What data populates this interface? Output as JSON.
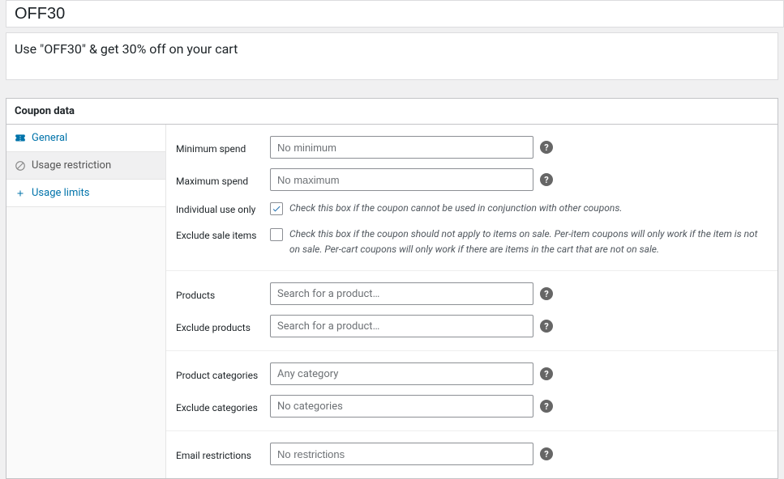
{
  "title": "OFF30",
  "description": "Use \"OFF30\" & get 30% off on your cart",
  "panel": {
    "title": "Coupon data"
  },
  "tabs": {
    "general": "General",
    "usage_restriction": "Usage restriction",
    "usage_limits": "Usage limits"
  },
  "labels": {
    "min_spend": "Minimum spend",
    "max_spend": "Maximum spend",
    "individual": "Individual use only",
    "exclude_sale": "Exclude sale items",
    "products": "Products",
    "exclude_products": "Exclude products",
    "product_categories": "Product categories",
    "exclude_categories": "Exclude categories",
    "email_restrictions": "Email restrictions"
  },
  "placeholders": {
    "min_spend": "No minimum",
    "max_spend": "No maximum",
    "search_product": "Search for a product…",
    "any_category": "Any category",
    "no_categories": "No categories",
    "no_restrictions": "No restrictions"
  },
  "hints": {
    "individual": "Check this box if the coupon cannot be used in conjunction with other coupons.",
    "exclude_sale": "Check this box if the coupon should not apply to items on sale. Per-item coupons will only work if the item is not on sale. Per-cart coupons will only work if there are items in the cart that are not on sale."
  },
  "state": {
    "individual_checked": true,
    "exclude_sale_checked": false
  },
  "help_glyph": "?"
}
